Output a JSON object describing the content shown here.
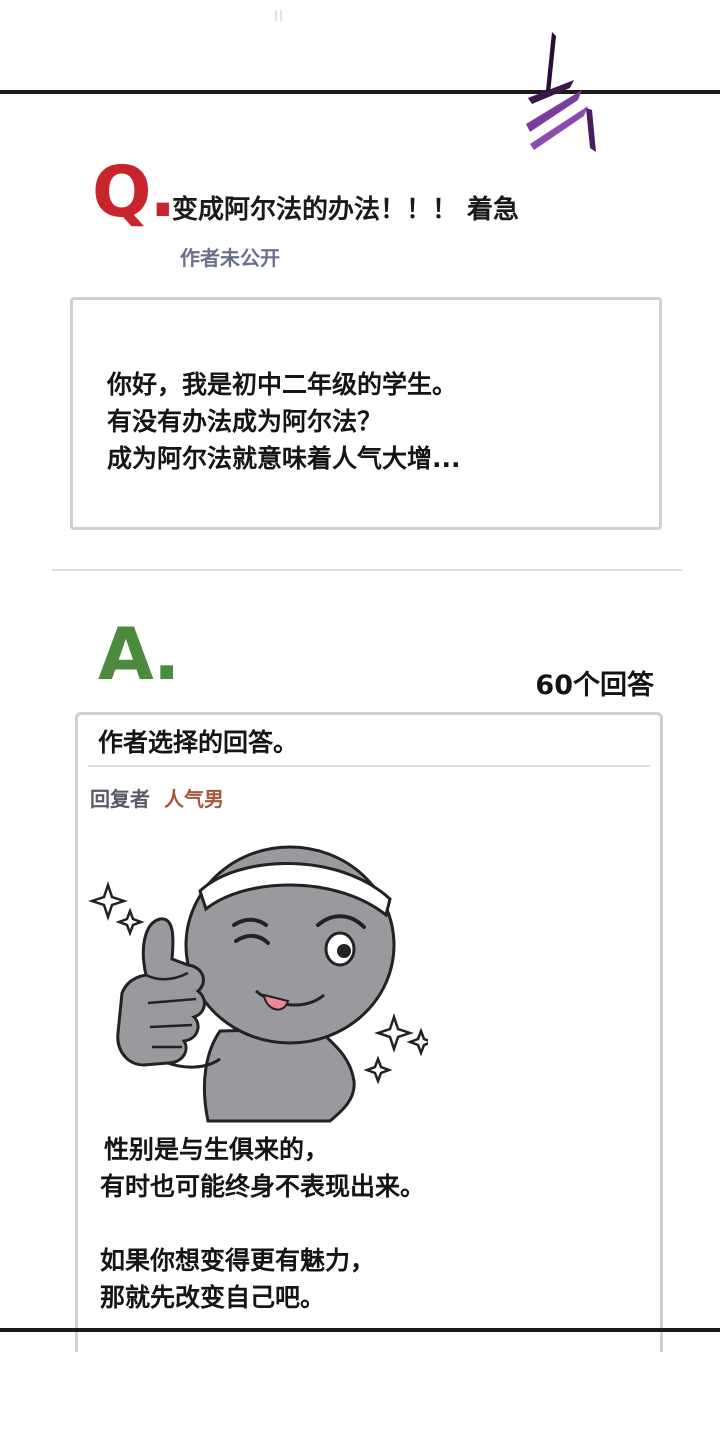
{
  "question": {
    "marker": "Q.",
    "title": "变成阿尔法的办法！！！ 着急",
    "author": "作者未公开",
    "body": [
      "你好，我是初中二年级的学生。",
      "有没有办法成为阿尔法？",
      "成为阿尔法就意味着人气大增..."
    ]
  },
  "answer": {
    "marker": "A.",
    "count_label": "60个回答",
    "chosen_label": "作者选择的回答。",
    "replier_label": "回复者",
    "replier_name": "人气男",
    "body": [
      "性别是与生俱来的，",
      "有时也可能终身不表现出来。",
      "",
      "如果你想变得更有魅力，",
      "那就先改变自己吧。"
    ]
  },
  "colors": {
    "q_marker": "#c8242d",
    "a_marker": "#4c8a3e",
    "author_text": "#6a6f8a",
    "replier_name": "#a2583a",
    "slash_mark": "#5b2a6e"
  }
}
